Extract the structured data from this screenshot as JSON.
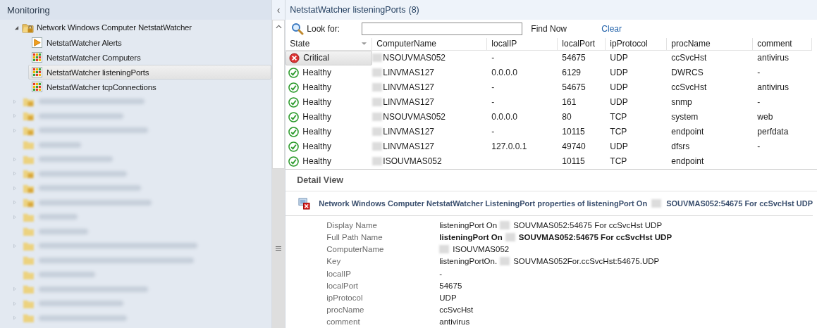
{
  "navigation": {
    "title": "Monitoring",
    "collapse_glyph": "‹",
    "tree": {
      "label": "Network Windows Computer NetstatWatcher",
      "expanded": true,
      "children": [
        {
          "label": "NetstatWatcher Alerts",
          "kind": "alert",
          "selected": false
        },
        {
          "label": "NetstatWatcher Computers",
          "kind": "state",
          "selected": false
        },
        {
          "label": "NetstatWatcher listeningPorts",
          "kind": "state",
          "selected": true
        },
        {
          "label": "NetstatWatcher tcpConnections",
          "kind": "state",
          "selected": false
        }
      ]
    },
    "redacted_folders": [
      {
        "expandable": true,
        "locked": true
      },
      {
        "expandable": true,
        "locked": true
      },
      {
        "expandable": true,
        "locked": true
      },
      {
        "expandable": false,
        "locked": false
      },
      {
        "expandable": true,
        "locked": false
      },
      {
        "expandable": true,
        "locked": true
      },
      {
        "expandable": true,
        "locked": true
      },
      {
        "expandable": true,
        "locked": true
      },
      {
        "expandable": true,
        "locked": false
      },
      {
        "expandable": false,
        "locked": false
      },
      {
        "expandable": true,
        "locked": false
      },
      {
        "expandable": false,
        "locked": false
      },
      {
        "expandable": false,
        "locked": false
      },
      {
        "expandable": true,
        "locked": false
      },
      {
        "expandable": true,
        "locked": false
      },
      {
        "expandable": true,
        "locked": false
      }
    ]
  },
  "view": {
    "title": "NetstatWatcher listeningPorts",
    "count": "(8)",
    "search": {
      "label": "Look for:",
      "find_button": "Find Now",
      "clear_link": "Clear"
    },
    "table": {
      "columns": [
        "State",
        "ComputerName",
        "localIP",
        "localPort",
        "ipProtocol",
        "procName",
        "comment"
      ],
      "rows": [
        {
          "kind": "critical",
          "selected": true,
          "cells": [
            "Critical",
            "NSOUVMAS052",
            "-",
            "54675",
            "UDP",
            "ccSvcHst",
            "antivirus"
          ]
        },
        {
          "kind": "healthy",
          "selected": false,
          "cells": [
            "Healthy",
            "LINVMAS127",
            "0.0.0.0",
            "6129",
            "UDP",
            "DWRCS",
            "-"
          ]
        },
        {
          "kind": "healthy",
          "selected": false,
          "cells": [
            "Healthy",
            "LINVMAS127",
            "-",
            "54675",
            "UDP",
            "ccSvcHst",
            "antivirus"
          ]
        },
        {
          "kind": "healthy",
          "selected": false,
          "cells": [
            "Healthy",
            "LINVMAS127",
            "-",
            "161",
            "UDP",
            "snmp",
            "-"
          ]
        },
        {
          "kind": "healthy",
          "selected": false,
          "cells": [
            "Healthy",
            "NSOUVMAS052",
            "0.0.0.0",
            "80",
            "TCP",
            "system",
            "web"
          ]
        },
        {
          "kind": "healthy",
          "selected": false,
          "cells": [
            "Healthy",
            "LINVMAS127",
            "-",
            "10115",
            "TCP",
            "endpoint",
            "perfdata"
          ]
        },
        {
          "kind": "healthy",
          "selected": false,
          "cells": [
            "Healthy",
            "LINVMAS127",
            "127.0.0.1",
            "49740",
            "UDP",
            "dfsrs",
            "-"
          ]
        },
        {
          "kind": "healthy",
          "selected": false,
          "cells": [
            "Healthy",
            "ISOUVMAS052",
            null,
            "10115",
            "TCP",
            "endpoint",
            null
          ]
        }
      ]
    },
    "detail": {
      "title": "Detail View",
      "heading": [
        "Network Windows Computer NetstatWatcher ListeningPort properties of listeningPort On",
        "SOUVMAS052:54675 For ccSvcHst UDP"
      ],
      "properties": [
        {
          "name": "Display Name",
          "value": [
            {
              "kind": "text",
              "text": "listeningPort On"
            },
            {
              "kind": "redaction"
            },
            {
              "kind": "text",
              "text": "SOUVMAS052:54675 For ccSvcHst UDP"
            }
          ],
          "bold": false
        },
        {
          "name": "Full Path Name",
          "value": [
            {
              "kind": "text",
              "text": "listeningPort On"
            },
            {
              "kind": "redaction"
            },
            {
              "kind": "text",
              "text": "SOUVMAS052:54675 For ccSvcHst UDP"
            }
          ],
          "bold": true
        },
        {
          "name": "ComputerName",
          "value": [
            {
              "kind": "redaction"
            },
            {
              "kind": "text",
              "text": "ISOUVMAS052"
            }
          ],
          "bold": false
        },
        {
          "name": "Key",
          "value": [
            {
              "kind": "text",
              "text": "listeningPortOn."
            },
            {
              "kind": "redaction"
            },
            {
              "kind": "text",
              "text": "SOUVMAS052For.ccSvcHst:54675.UDP"
            }
          ],
          "bold": false
        },
        {
          "name": "localIP",
          "value": [
            {
              "kind": "text",
              "text": "-"
            }
          ],
          "bold": false
        },
        {
          "name": "localPort",
          "value": [
            {
              "kind": "text",
              "text": "54675"
            }
          ],
          "bold": false
        },
        {
          "name": "ipProtocol",
          "value": [
            {
              "kind": "text",
              "text": "UDP"
            }
          ],
          "bold": false
        },
        {
          "name": "procName",
          "value": [
            {
              "kind": "text",
              "text": "ccSvcHst"
            }
          ],
          "bold": false
        },
        {
          "name": "comment",
          "value": [
            {
              "kind": "text",
              "text": "antivirus"
            }
          ],
          "bold": false
        }
      ]
    }
  }
}
